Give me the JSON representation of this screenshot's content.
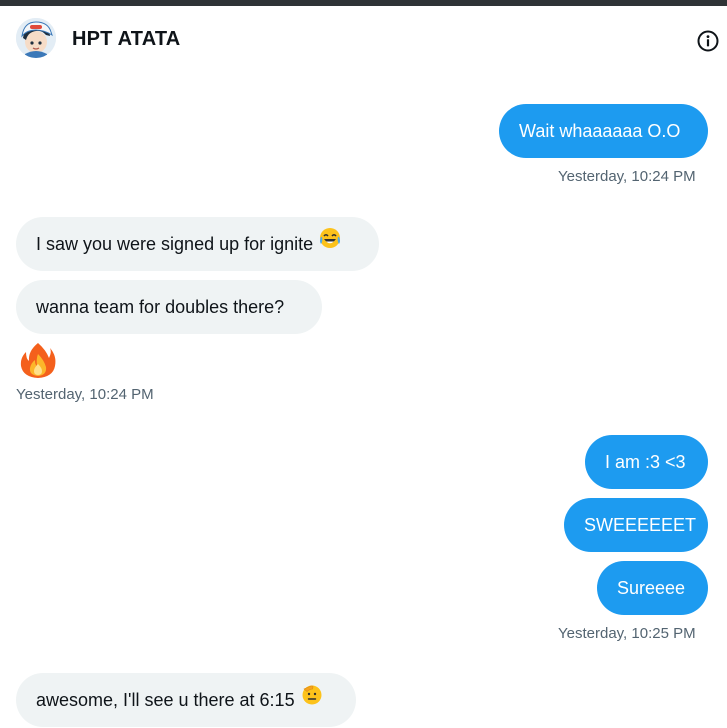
{
  "conversation": {
    "name": "HPT ATATA"
  },
  "messages": [
    {
      "direction": "sent",
      "text": "Wait whaaaaaa O.O"
    },
    {
      "direction": "received",
      "text": "I saw you were signed up for ignite",
      "emoji": "tears-of-joy-emoji"
    },
    {
      "direction": "received",
      "text": "wanna team for doubles there?"
    },
    {
      "direction": "received",
      "emoji": "fire-emoji"
    },
    {
      "direction": "sent",
      "text": "I am :3 <3"
    },
    {
      "direction": "sent",
      "text": "SWEEEEEET"
    },
    {
      "direction": "sent",
      "text": "Sureeee"
    },
    {
      "direction": "received",
      "text": "awesome, I'll see u there at 6:15",
      "emoji": "saluting-face-emoji"
    }
  ],
  "timestamps": [
    "Yesterday, 10:24 PM",
    "Yesterday, 10:24 PM",
    "Yesterday, 10:25 PM"
  ],
  "colors": {
    "sent_bubble": "#1d9bf0",
    "received_bubble": "#eff3f4",
    "timestamp": "#536471"
  }
}
